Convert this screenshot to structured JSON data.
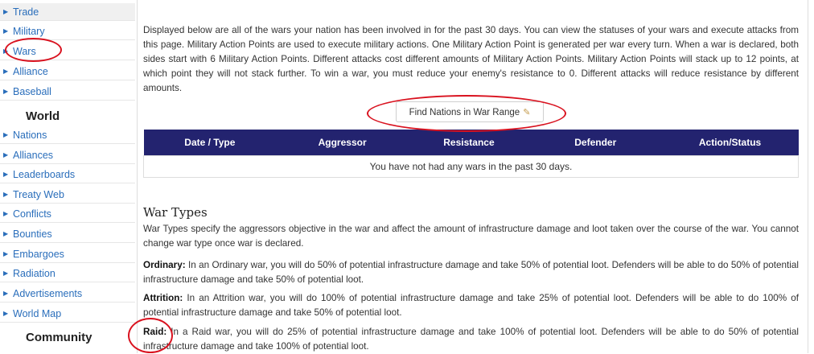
{
  "sidebar": {
    "nav_items": [
      {
        "label": "Trade"
      },
      {
        "label": "Military"
      },
      {
        "label": "Wars"
      },
      {
        "label": "Alliance"
      },
      {
        "label": "Baseball"
      }
    ],
    "world_title": "World",
    "world_items": [
      {
        "label": "Nations"
      },
      {
        "label": "Alliances"
      },
      {
        "label": "Leaderboards"
      },
      {
        "label": "Treaty Web"
      },
      {
        "label": "Conflicts"
      },
      {
        "label": "Bounties"
      },
      {
        "label": "Embargoes"
      },
      {
        "label": "Radiation"
      },
      {
        "label": "Advertisements"
      },
      {
        "label": "World Map"
      }
    ],
    "community_title": "Community"
  },
  "main": {
    "intro": "Displayed below are all of the wars your nation has been involved in for the past 30 days. You can view the statuses of your wars and execute attacks from this page. Military Action Points are used to execute military actions. One Military Action Point is generated per war every turn. When a war is declared, both sides start with 6 Military Action Points. Different attacks cost different amounts of Military Action Points. Military Action Points will stack up to 12 points, at which point they will not stack further. To win a war, you must reduce your enemy's resistance to 0. Different attacks will reduce resistance by different amounts.",
    "find_button": "Find Nations in War Range",
    "table": {
      "headers": [
        "Date / Type",
        "Aggressor",
        "Resistance",
        "Defender",
        "Action/Status"
      ],
      "empty_message": "You have not had any wars in the past 30 days."
    },
    "war_types_title": "War Types",
    "war_types_intro": "War Types specify the aggressors objective in the war and affect the amount of infrastructure damage and loot taken over the course of the war. You cannot change war type once war is declared.",
    "ordinary_label": "Ordinary:",
    "ordinary_text": " In an Ordinary war, you will do 50% of potential infrastructure damage and take 50% of potential loot. Defenders will be able to do 50% of potential infrastructure damage and take 50% of potential loot.",
    "attrition_label": "Attrition:",
    "attrition_text": " In an Attrition war, you will do 100% of potential infrastructure damage and take 25% of potential loot. Defenders will be able to do 100% of potential infrastructure damage and take 50% of potential loot.",
    "raid_label": "Raid:",
    "raid_text": " In a Raid war, you will do 25% of potential infrastructure damage and take 100% of potential loot. Defenders will be able to do 50% of potential infrastructure damage and take 100% of potential loot."
  },
  "colors": {
    "link": "#2a6ebb",
    "table_header": "#23236f",
    "annotation": "#d9121f"
  },
  "icons": {
    "nav_bullet": "triangle-right-icon",
    "button_icon": "pencil-icon"
  }
}
